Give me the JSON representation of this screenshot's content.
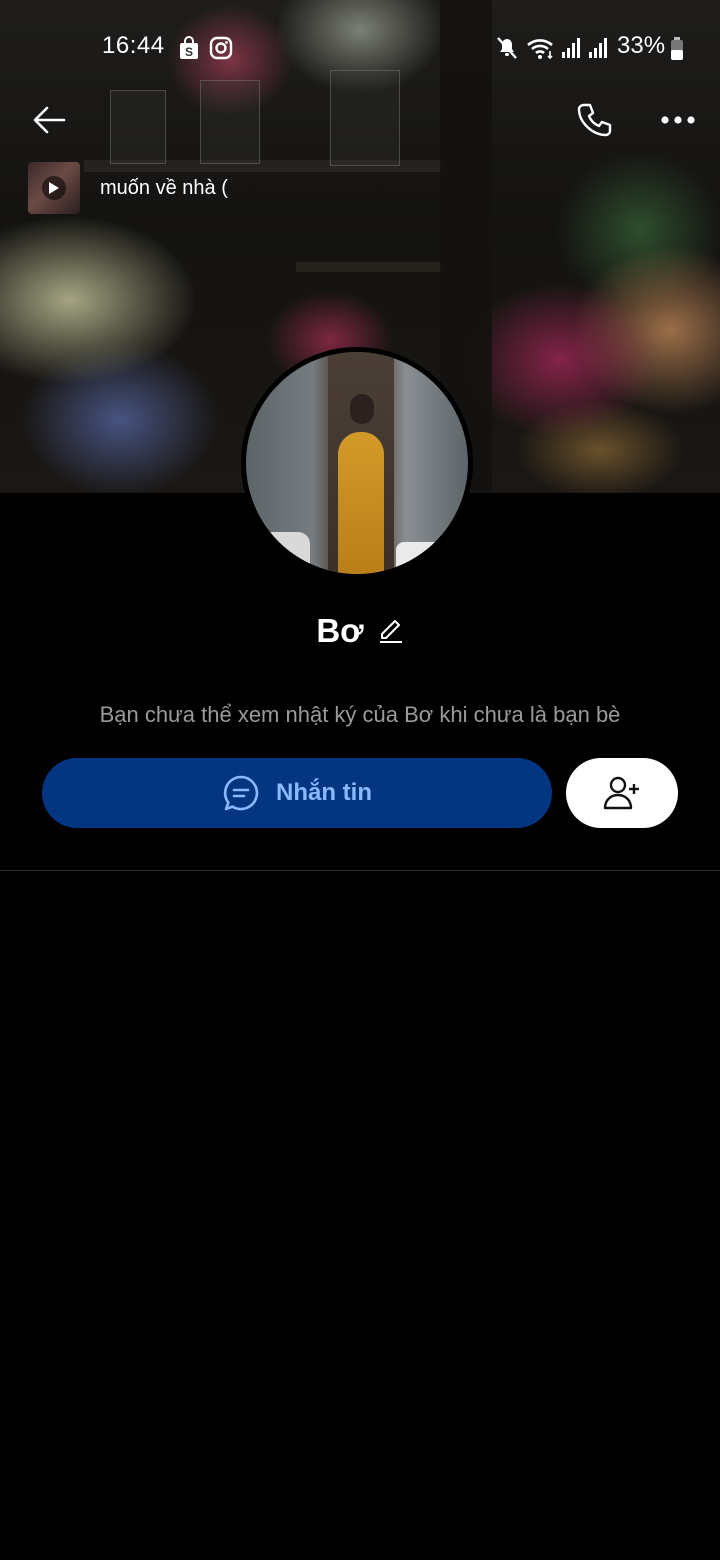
{
  "status_bar": {
    "time": "16:44",
    "battery": "33%",
    "icons": [
      "shopee-icon",
      "instagram-icon",
      "mute-icon",
      "wifi-icon",
      "signal-icon",
      "signal-icon-2",
      "battery-icon"
    ]
  },
  "header": {
    "back_icon": "arrow-left-icon",
    "call_icon": "phone-icon",
    "more_icon": "more-icon"
  },
  "music": {
    "title": "muốn về nhà ("
  },
  "profile": {
    "name": "Bơ",
    "notice": "Bạn chưa thể xem nhật ký của Bơ khi chưa là bạn bè"
  },
  "actions": {
    "message_label": "Nhắn tin",
    "message_icon": "chat-icon",
    "add_friend_icon": "add-friend-icon"
  },
  "colors": {
    "background": "#000000",
    "message_button_bg": "#043580",
    "message_button_text": "#8ab9ff",
    "notice_text": "#9a9a9a"
  }
}
